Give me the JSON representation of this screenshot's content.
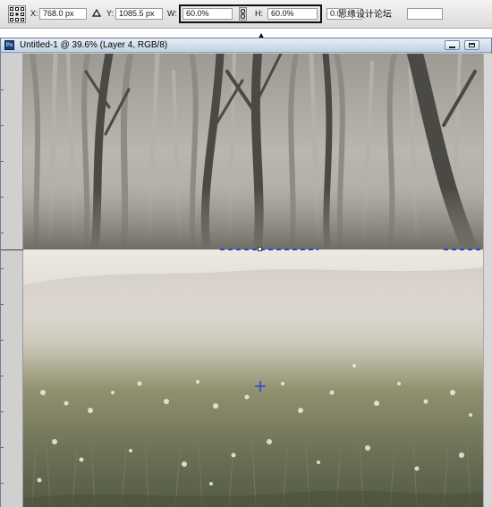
{
  "options_bar": {
    "x_label": "X:",
    "x_value": "768.0 px",
    "y_label": "Y:",
    "y_value": "1085.5 px",
    "w_label": "W:",
    "w_value": "60.0%",
    "h_label": "H:",
    "h_value": "60.0%",
    "rotate_value": "0.0",
    "watermark": "思缘设计论坛",
    "reference_point_icon": "reference-point-grid-icon",
    "link_icon": "chain-link-icon",
    "delta_icon": "delta-triangle-icon"
  },
  "annotation": {
    "highlight_color": "#111111",
    "arrow_icon": "curved-arrow-icon"
  },
  "document": {
    "title": "Untitled-1 @ 39.6% (Layer 4, RGB/8)",
    "app_icon_text": "Ps",
    "minimize_icon": "minimize-icon",
    "maximize_icon": "maximize-icon"
  },
  "canvas": {
    "upper_layer": "foggy-forest-image",
    "lower_layer": "misty-meadow-image",
    "selection_color": "#2a45d6"
  }
}
